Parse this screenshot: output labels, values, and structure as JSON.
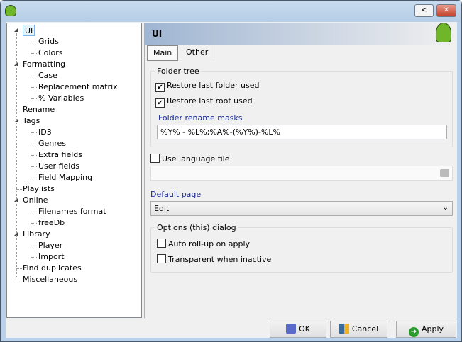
{
  "titlebar": {
    "back_label": "<",
    "close_label": "✕"
  },
  "tree": [
    {
      "label": "UI",
      "level": 0,
      "expanded": true,
      "selected": true
    },
    {
      "label": "Grids",
      "level": 1
    },
    {
      "label": "Colors",
      "level": 1
    },
    {
      "label": "Formatting",
      "level": 0,
      "expanded": true
    },
    {
      "label": "Case",
      "level": 1
    },
    {
      "label": "Replacement matrix",
      "level": 1
    },
    {
      "label": "% Variables",
      "level": 1
    },
    {
      "label": "Rename",
      "level": 0
    },
    {
      "label": "Tags",
      "level": 0,
      "expanded": true
    },
    {
      "label": "ID3",
      "level": 1
    },
    {
      "label": "Genres",
      "level": 1
    },
    {
      "label": "Extra fields",
      "level": 1
    },
    {
      "label": "User fields",
      "level": 1
    },
    {
      "label": "Field Mapping",
      "level": 1
    },
    {
      "label": "Playlists",
      "level": 0
    },
    {
      "label": "Online",
      "level": 0,
      "expanded": true
    },
    {
      "label": "Filenames format",
      "level": 1
    },
    {
      "label": "freeDb",
      "level": 1
    },
    {
      "label": "Library",
      "level": 0,
      "expanded": true
    },
    {
      "label": "Player",
      "level": 1
    },
    {
      "label": "Import",
      "level": 1
    },
    {
      "label": "Find duplicates",
      "level": 0
    },
    {
      "label": "Miscellaneous",
      "level": 0
    }
  ],
  "panel": {
    "title": "UI",
    "tabs": [
      "Main",
      "Other"
    ],
    "active_tab": "Main"
  },
  "folder_tree": {
    "label": "Folder tree",
    "restore_folder": "Restore last folder used",
    "restore_folder_checked": true,
    "restore_root": "Restore last root used",
    "restore_root_checked": true,
    "masks_label": "Folder rename masks",
    "masks_value": "%Y% - %L%;%A%-(%Y%)-%L%"
  },
  "language": {
    "label": "Use language file",
    "checked": false,
    "value": ""
  },
  "default_page": {
    "label": "Default page",
    "value": "Edit"
  },
  "options": {
    "label": "Options (this) dialog",
    "auto_rollup": "Auto roll-up on apply",
    "transparent": "Transparent  when inactive"
  },
  "buttons": {
    "ok": "OK",
    "cancel": "Cancel",
    "apply": "Apply"
  }
}
